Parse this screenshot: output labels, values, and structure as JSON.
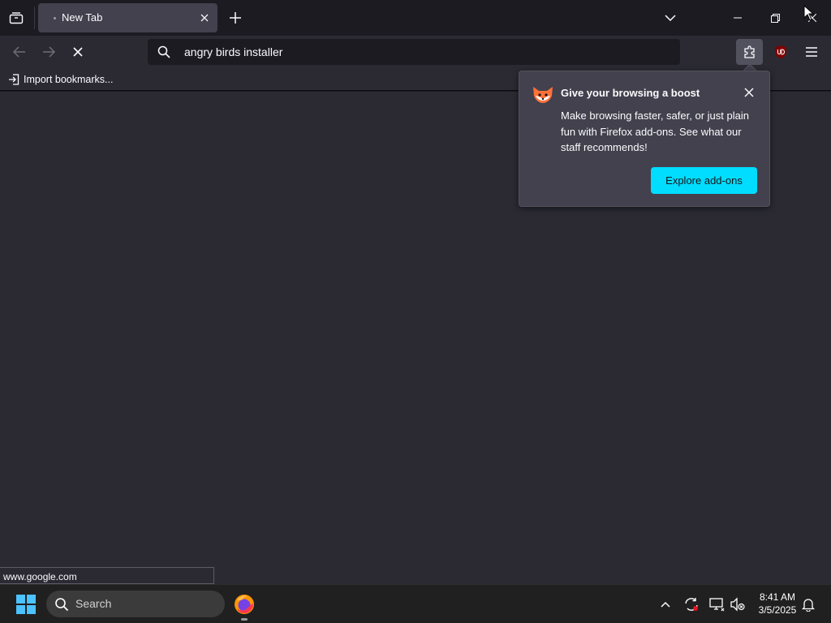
{
  "tab": {
    "title": "New Tab"
  },
  "urlbar": {
    "value": "angry birds installer"
  },
  "bookmarks": {
    "import_label": "Import bookmarks..."
  },
  "popup": {
    "title": "Give your browsing a boost",
    "body": "Make browsing faster, safer, or just plain fun with Firefox add-ons. See what our staff recommends!",
    "button_label": "Explore add-ons"
  },
  "status": {
    "url": "www.google.com"
  },
  "taskbar": {
    "search_label": "Search",
    "time": "8:41 AM",
    "date": "3/5/2025"
  },
  "colors": {
    "accent": "#00ddff",
    "toolbar": "#2b2a33",
    "titlebar": "#1c1b22",
    "popup_bg": "#42414d",
    "windows_blue": "#4cc2ff"
  },
  "icons": [
    "tab-list-icon",
    "close-icon",
    "plus-icon",
    "chevron-down-icon",
    "minimize-icon",
    "restore-icon",
    "back-arrow-icon",
    "forward-arrow-icon",
    "stop-icon",
    "search-icon",
    "puzzle-piece-icon",
    "ublock-origin-icon",
    "hamburger-menu-icon",
    "import-icon",
    "fox-icon",
    "windows-logo-icon",
    "firefox-icon",
    "chevron-up-icon",
    "sync-icon",
    "network-icon",
    "volume-muted-icon",
    "bell-icon",
    "mouse-cursor-icon"
  ]
}
